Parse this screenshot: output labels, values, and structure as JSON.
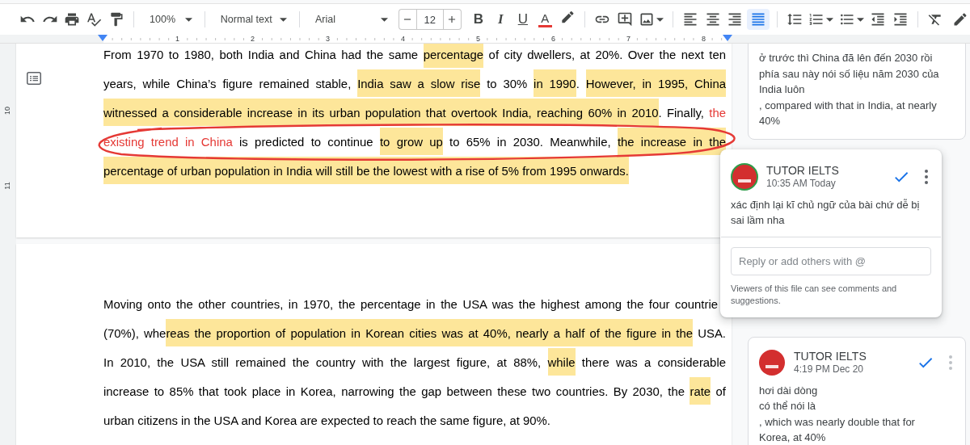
{
  "toolbar": {
    "zoom": "100%",
    "paragraph_style": "Normal text",
    "font": "Arial",
    "font_size": "12",
    "format_buttons": [
      {
        "kind": "bold",
        "label": "B"
      },
      {
        "kind": "italic",
        "label": "I"
      },
      {
        "kind": "underline",
        "label": "U"
      },
      {
        "kind": "text-color",
        "label": "A"
      }
    ],
    "alignments": [
      {
        "kind": "left",
        "selected": false
      },
      {
        "kind": "center",
        "selected": false
      },
      {
        "kind": "right",
        "selected": false
      },
      {
        "kind": "justify",
        "selected": true
      }
    ]
  },
  "ruler": {
    "numbers": [
      "1",
      "2",
      "3",
      "4",
      "5",
      "6",
      "7",
      "8"
    ]
  },
  "vertical_ruler": {
    "numbers": [
      "10",
      "11"
    ]
  },
  "document": {
    "pages": [
      {
        "lines": [
          {
            "cut_off": false,
            "runs": [
              {
                "text": "From 1970 to 1980, both India and China had the same ",
                "highlighted": false,
                "red_text": false
              },
              {
                "text": "percentage",
                "highlighted": true,
                "red_text": false
              },
              {
                "text": " of city dwellers, at 20%. Over the next ten",
                "highlighted": false,
                "red_text": false
              }
            ]
          },
          {
            "cut_off": false,
            "runs": [
              {
                "text": "years, while China’s figure remained stable, ",
                "highlighted": false,
                "red_text": false
              },
              {
                "text": "India saw a slow rise",
                "highlighted": true,
                "red_text": false
              },
              {
                "text": " to 30% ",
                "highlighted": false,
                "red_text": false
              },
              {
                "text": "in 1990",
                "highlighted": true,
                "red_text": false
              },
              {
                "text": ". ",
                "highlighted": false,
                "red_text": false
              },
              {
                "text": "However, in 1995, China",
                "highlighted": true,
                "red_text": false
              }
            ]
          },
          {
            "cut_off": false,
            "runs": [
              {
                "text": "witnessed a considerable increase in its urban population that overtook India, reaching 60% in 2010",
                "highlighted": true,
                "red_text": false
              },
              {
                "text": ". Finally, ",
                "highlighted": false,
                "red_text": false
              },
              {
                "text": "the",
                "highlighted": false,
                "red_text": true
              }
            ]
          },
          {
            "cut_off": false,
            "runs": [
              {
                "text": "existing trend in China",
                "highlighted": false,
                "red_text": true
              },
              {
                "text": " is predicted to continue ",
                "highlighted": false,
                "red_text": false
              },
              {
                "text": "to grow up",
                "highlighted": true,
                "red_text": false
              },
              {
                "text": " to 65% in 2030. Meanwhile, ",
                "highlighted": false,
                "red_text": false
              },
              {
                "text": "the increase in the",
                "highlighted": true,
                "red_text": false
              }
            ]
          },
          {
            "cut_off": false,
            "runs": [
              {
                "text": "percentage of urban population in India will still be the lowest with a rise of 5% from 1995 onwards.",
                "highlighted": true,
                "red_text": false
              }
            ]
          }
        ]
      },
      {
        "lines": [
          {
            "cut_off": true,
            "runs": [
              {
                "text": "Moving onto the other countries, in 1970, the percentage in the USA was the highest among the four countrie",
                "highlighted": false,
                "red_text": false
              }
            ]
          },
          {
            "cut_off": false,
            "runs": [
              {
                "text": "(70%), whe",
                "highlighted": false,
                "red_text": false
              },
              {
                "text": "reas the proportion of population in Korean cities was at 40%, nearly a half of the figure in the",
                "highlighted": true,
                "red_text": false
              },
              {
                "text": " USA.",
                "highlighted": false,
                "red_text": false
              }
            ]
          },
          {
            "cut_off": false,
            "runs": [
              {
                "text": "In 2010, the USA still remained the country with the largest figure, at 88%, ",
                "highlighted": false,
                "red_text": false
              },
              {
                "text": "while",
                "highlighted": true,
                "red_text": false
              },
              {
                "text": " there was a considerable",
                "highlighted": false,
                "red_text": false
              }
            ]
          },
          {
            "cut_off": false,
            "runs": [
              {
                "text": "increase to 85% that took place in Korea, narrowing the gap between these two countries. By 2030, the ",
                "highlighted": false,
                "red_text": false
              },
              {
                "text": "rate",
                "highlighted": true,
                "red_text": false
              },
              {
                "text": " of",
                "highlighted": false,
                "red_text": false
              }
            ]
          },
          {
            "cut_off": false,
            "runs": [
              {
                "text": "urban citizens in the USA and Korea are expected to reach the same figure, at 90%.",
                "highlighted": false,
                "red_text": false
              }
            ]
          }
        ]
      }
    ]
  },
  "comments": [
    {
      "selected": false,
      "body": [
        "ở trước thì China đã lên đến 2030 rồi phía sau này nói số liệu năm 2030 của India luôn",
        ", compared with that in India, at nearly 40%"
      ]
    },
    {
      "selected": true,
      "author": "TUTOR IELTS",
      "time": "10:35 AM Today",
      "body": [
        "xác định lại kĩ chủ ngữ của bài chứ dễ bị sai lầm nha"
      ],
      "reply_placeholder": "Reply or add others with @",
      "notice": "Viewers of this file can see comments and suggestions."
    },
    {
      "selected": false,
      "author": "TUTOR IELTS",
      "time": "4:19 PM Dec 20",
      "body": [
        "hơi dài dòng",
        "có thể nói là",
        ", which was nearly double that for Korea, at 40%"
      ]
    }
  ]
}
